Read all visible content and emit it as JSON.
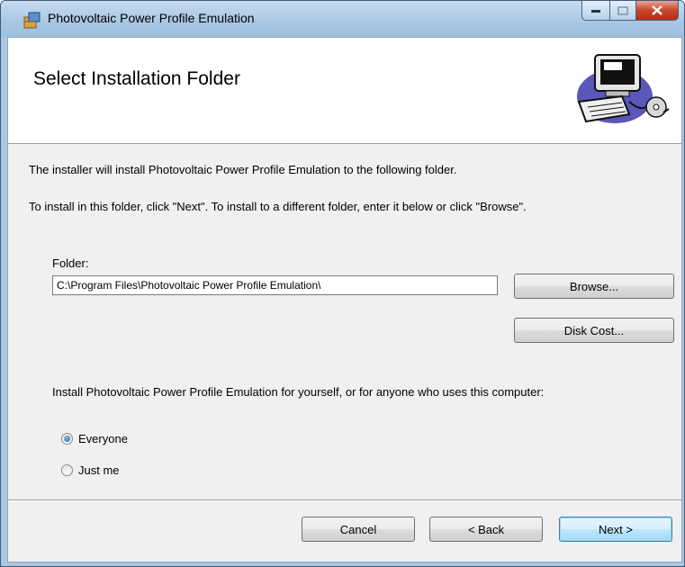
{
  "window": {
    "title": "Photovoltaic Power Profile Emulation",
    "icons": {
      "app": "installer-icon",
      "minimize": "minimize-icon",
      "maximize": "maximize-icon",
      "close": "close-icon"
    }
  },
  "banner": {
    "title": "Select Installation Folder",
    "art_icon": "computer-with-disc-clipart"
  },
  "body": {
    "line1": "The installer will install Photovoltaic Power Profile Emulation to the following folder.",
    "line2": "To install in this folder, click \"Next\". To install to a different folder, enter it below or click \"Browse\".",
    "folder_label": "Folder:",
    "folder_value": "C:\\Program Files\\Photovoltaic Power Profile Emulation\\",
    "browse_label": "Browse...",
    "disk_cost_label": "Disk Cost...",
    "scope_prompt": "Install Photovoltaic Power Profile Emulation for yourself, or for anyone who uses this computer:",
    "options": [
      {
        "label": "Everyone",
        "selected": true
      },
      {
        "label": "Just me",
        "selected": false
      }
    ]
  },
  "footer": {
    "cancel_label": "Cancel",
    "back_label": "< Back",
    "next_label": "Next >"
  },
  "colors": {
    "accent": "#3c7fb1",
    "titlebar": "#a8c6e3",
    "close": "#c9452b"
  }
}
